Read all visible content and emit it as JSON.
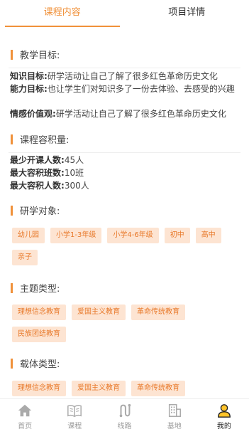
{
  "tabs": [
    {
      "label": "课程内容",
      "active": true
    },
    {
      "label": "项目详情",
      "active": false
    }
  ],
  "sections": {
    "goals": {
      "title": "教学目标:",
      "rows": [
        {
          "label": "知识目标:",
          "text": "研学活动让自己了解了很多红色革命历史文化"
        },
        {
          "label": "能力目标:",
          "text": "也让学生们对知识多了一份去体验、去感受的兴趣"
        },
        {
          "label": "情感价值观:",
          "text": "研学活动让自己了解了很多红色革命历史文化"
        }
      ]
    },
    "capacity": {
      "title": "课程容积量:",
      "rows": [
        {
          "label": "最少开课人数:",
          "text": "45人"
        },
        {
          "label": "最大容积班数:",
          "text": "10班"
        },
        {
          "label": "最大容积人数:",
          "text": "300人"
        }
      ]
    },
    "audience": {
      "title": "研学对象:",
      "chips": [
        "幼儿园",
        "小学1-3年级",
        "小学4-6年级",
        "初中",
        "高中",
        "亲子"
      ]
    },
    "theme": {
      "title": "主题类型:",
      "chips": [
        "理想信念教育",
        "爱国主义教育",
        "革命传统教育",
        "民族团结教育"
      ]
    },
    "carrier": {
      "title": "载体类型:",
      "chips": [
        "理想信念教育",
        "爱国主义教育",
        "革命传统教育"
      ]
    }
  },
  "nav": [
    {
      "label": "首页",
      "icon": "home-icon"
    },
    {
      "label": "课程",
      "icon": "book-icon"
    },
    {
      "label": "线路",
      "icon": "route-icon"
    },
    {
      "label": "基地",
      "icon": "building-icon"
    },
    {
      "label": "我的",
      "icon": "user-icon",
      "active": true
    }
  ],
  "colors": {
    "accent": "#f0913a",
    "chip_bg": "#fde4d2",
    "chip_text": "#e8792a"
  }
}
